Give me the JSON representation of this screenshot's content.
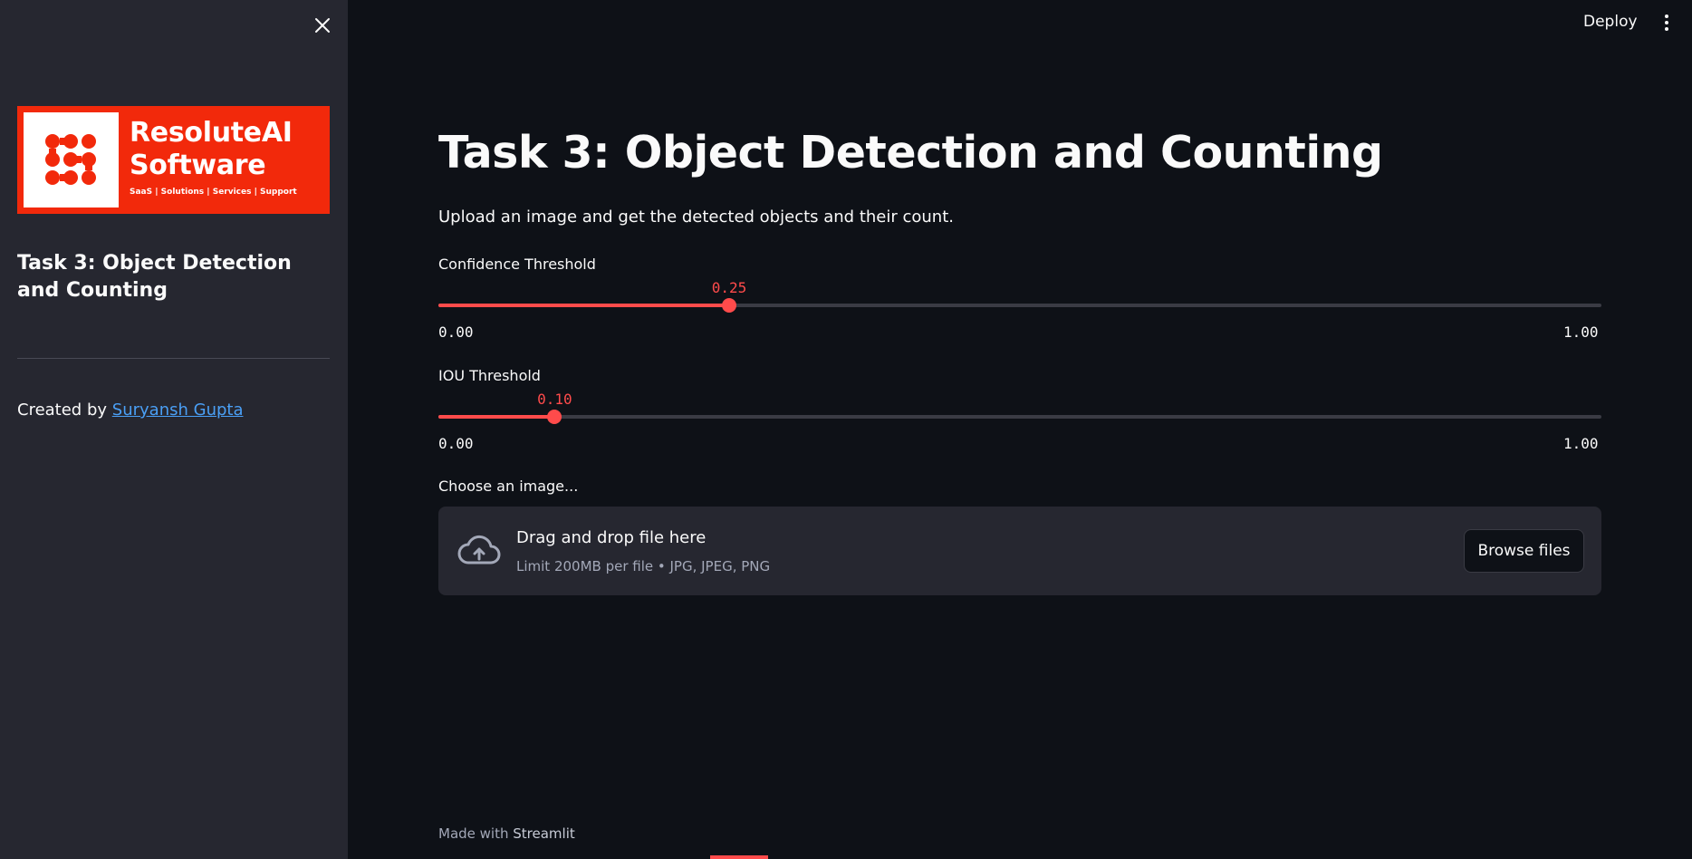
{
  "sidebar": {
    "close_icon": "close-icon",
    "logo": {
      "name_line1": "ResoluteAI",
      "name_line2": "Software",
      "tagline": "SaaS  |  Solutions  |  Services  |  Support",
      "brand_color": "#f2290b"
    },
    "title": "Task 3: Object Detection and Counting",
    "credit_prefix": "Created by",
    "credit_link": "Suryansh Gupta"
  },
  "header": {
    "deploy_label": "Deploy",
    "menu_icon": "kebab-menu-icon"
  },
  "main": {
    "title": "Task 3: Object Detection and Counting",
    "subtitle": "Upload an image and get the detected objects and their count.",
    "sliders": [
      {
        "label": "Confidence Threshold",
        "value": "0.25",
        "value_num": 0.25,
        "min": "0.00",
        "max": "1.00",
        "min_num": 0,
        "max_num": 1
      },
      {
        "label": "IOU Threshold",
        "value": "0.10",
        "value_num": 0.1,
        "min": "0.00",
        "max": "1.00",
        "min_num": 0,
        "max_num": 1
      }
    ],
    "uploader": {
      "label": "Choose an image...",
      "drop_title": "Drag and drop file here",
      "limit_text": "Limit 200MB per file • JPG, JPEG, PNG",
      "browse_label": "Browse files",
      "icon": "cloud-upload-icon"
    }
  },
  "footer": {
    "made_with": "Made with",
    "brand": "Streamlit"
  },
  "colors": {
    "accent": "#ff4b4b",
    "background": "#0e1117",
    "sidebar": "#262730",
    "link": "#4a9ff5"
  }
}
